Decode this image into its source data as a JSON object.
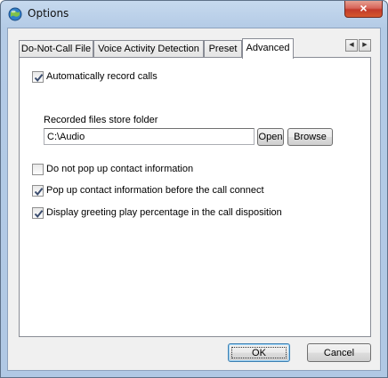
{
  "window": {
    "title": "Options",
    "close_glyph": "×"
  },
  "tabs": [
    {
      "label": "Do-Not-Call File",
      "active": false
    },
    {
      "label": "Voice Activity Detection",
      "active": false
    },
    {
      "label": "Preset",
      "active": false
    },
    {
      "label": "Advanced",
      "active": true
    }
  ],
  "tab_scroll": {
    "left_glyph": "◀",
    "right_glyph": "▶"
  },
  "advanced": {
    "auto_record": {
      "label": "Automatically record calls",
      "checked": true
    },
    "folder": {
      "label": "Recorded files store folder",
      "value": "C:\\Audio",
      "open_label": "Open",
      "browse_label": "Browse"
    },
    "no_popup": {
      "label": "Do not pop up contact information",
      "checked": false
    },
    "popup_before": {
      "label": "Pop up contact information before the call connect",
      "checked": true
    },
    "greeting_percentage": {
      "label": "Display greeting play percentage in the call disposition",
      "checked": true
    }
  },
  "footer": {
    "ok_label": "OK",
    "cancel_label": "Cancel"
  },
  "icons": {
    "app": "app-globe-icon",
    "close": "close-icon",
    "check": "checkmark-icon"
  },
  "colors": {
    "title_bar": "#b4cbe6",
    "close_button": "#c23b2b",
    "panel_background": "#ffffff",
    "dialog_background": "#f0f0f0",
    "default_button_border": "#3c7fb1"
  }
}
